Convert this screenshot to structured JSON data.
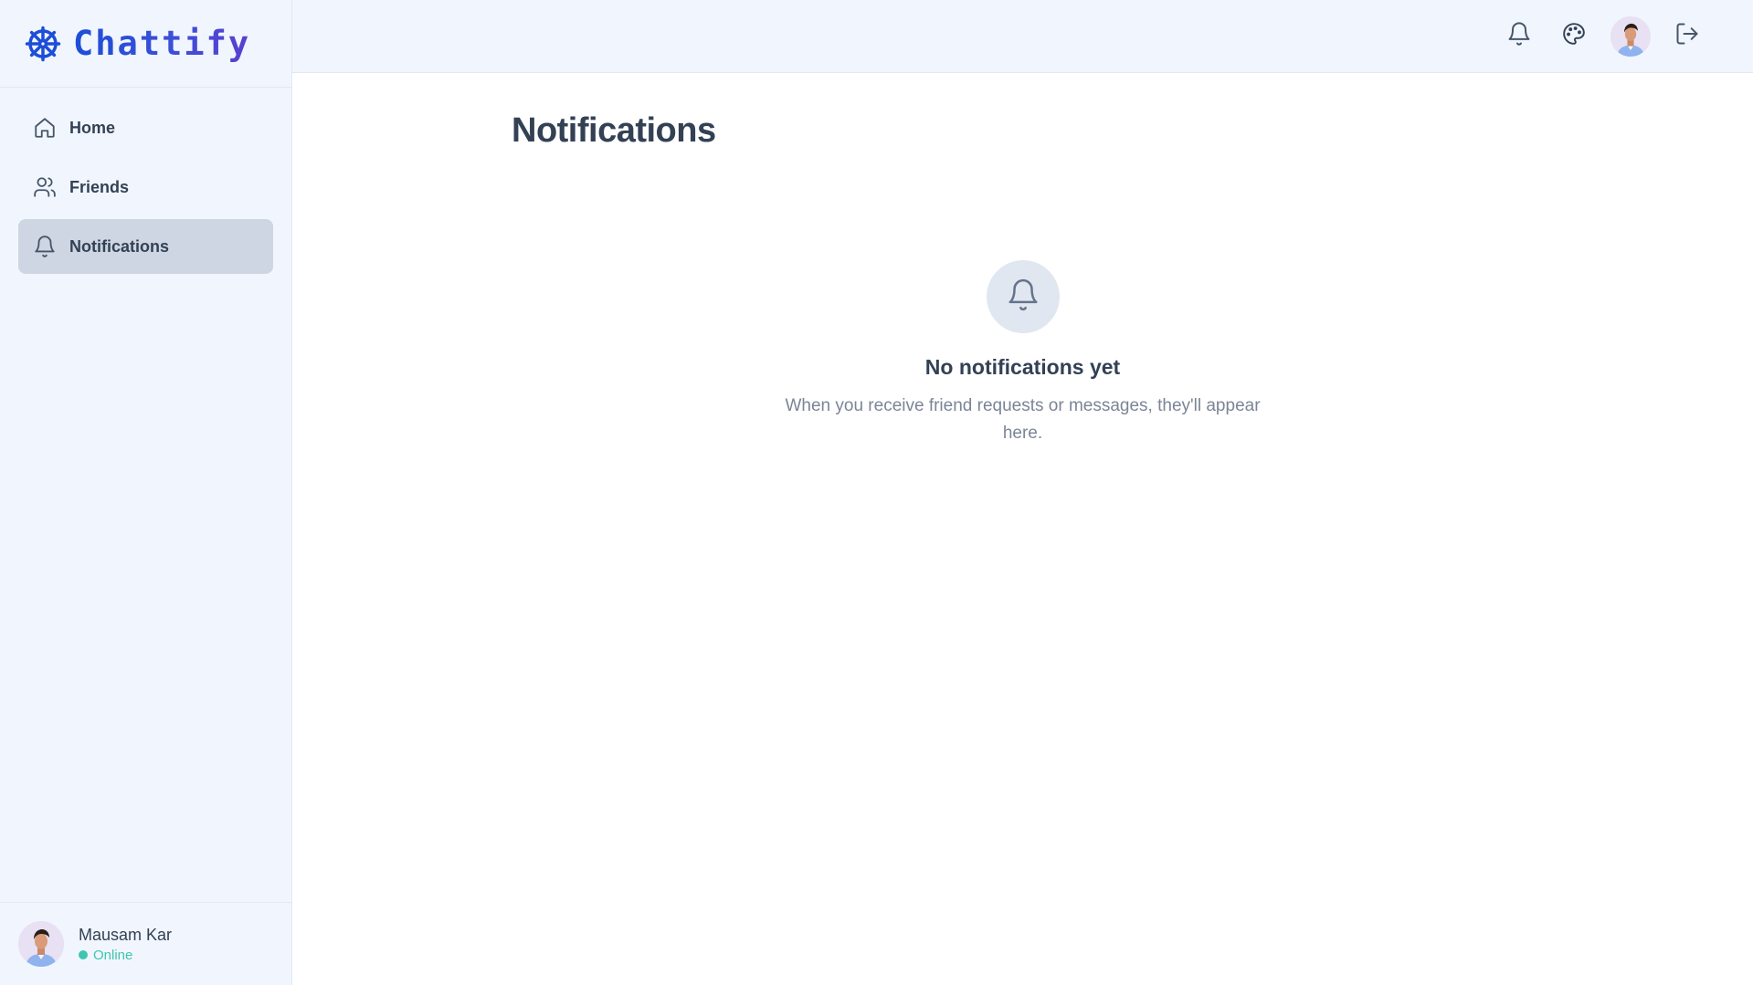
{
  "brand": {
    "name": "Chattify",
    "icon": "ship-wheel-icon",
    "accent": "#1d4ed8"
  },
  "sidebar": {
    "items": [
      {
        "label": "Home",
        "icon": "home-icon"
      },
      {
        "label": "Friends",
        "icon": "users-icon"
      },
      {
        "label": "Notifications",
        "icon": "bell-icon",
        "active": true
      }
    ]
  },
  "user": {
    "name": "Mausam Kar",
    "status": "Online",
    "status_color": "#3fc5b0"
  },
  "topbar": {
    "icons": [
      "bell-icon",
      "palette-icon",
      "avatar",
      "logout-icon"
    ]
  },
  "page": {
    "title": "Notifications"
  },
  "empty_state": {
    "icon": "bell-icon",
    "title": "No notifications yet",
    "description": "When you receive friend requests or messages, they'll appear here."
  }
}
